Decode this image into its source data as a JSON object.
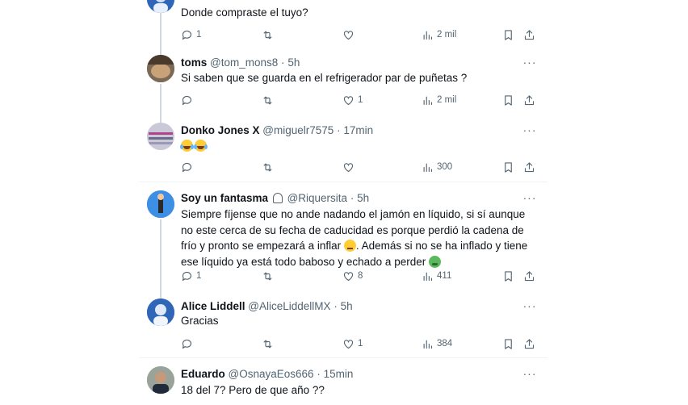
{
  "tweets": [
    {
      "name": "",
      "handle": "",
      "time": "",
      "text": "Donde compraste el tuyo?",
      "actions": {
        "replies": "1",
        "retweets": "",
        "likes": "",
        "views": "2 mil"
      }
    },
    {
      "name": "toms",
      "handle": "@tom_mons8",
      "time": "5h",
      "text": "Si saben que se guarda en el refrigerador par de puñetas ?",
      "actions": {
        "replies": "",
        "retweets": "",
        "likes": "1",
        "views": "2 mil"
      }
    },
    {
      "name": "Donko Jones X",
      "handle": "@miguelr7575",
      "time": "17min",
      "text": "",
      "actions": {
        "replies": "",
        "retweets": "",
        "likes": "",
        "views": "300"
      }
    },
    {
      "name": "Soy un fantasma",
      "handle": "@Riquersita",
      "time": "5h",
      "text_part1": "Siempre fíjense que no ande nadando el jamón en líquido, si sí aunque no este cerca de su fecha de caducidad es porque perdió la cadena de frío y pronto se empezará a inflar",
      "text_part2": ". Además si no se ha inflado y tiene ese líquido ya está todo baboso y echado a perder",
      "actions": {
        "replies": "1",
        "retweets": "",
        "likes": "8",
        "views": "411"
      }
    },
    {
      "name": "Alice Liddell",
      "handle": "@AliceLiddellMX",
      "time": "5h",
      "text": "Gracias",
      "actions": {
        "replies": "",
        "retweets": "",
        "likes": "1",
        "views": "384"
      }
    },
    {
      "name": "Eduardo",
      "handle": "@OsnayaEos666",
      "time": "15min",
      "text": "18 del 7? Pero de que año ??",
      "actions": {}
    }
  ],
  "separator": "·",
  "more_label": "···",
  "colors": {
    "text": "#0f1419",
    "secondary": "#536471",
    "divider": "#eff3f4",
    "thread_line": "#cfd9de"
  }
}
